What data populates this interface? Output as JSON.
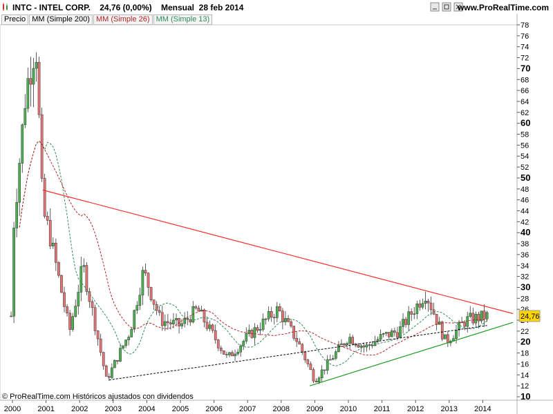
{
  "header": {
    "ticker": "INTC - INTEL CORP.",
    "price": "24,76 (0,00%)",
    "period": "Mensual  28 feb 2014",
    "site": "www.ProRealTime.com"
  },
  "legend": {
    "precio": "Precio",
    "ma200": "MM (Simple 200)",
    "ma26": "MM (Simple 26)",
    "ma13": "MM (Simple 13)"
  },
  "footer": {
    "copyright": "© ProRealTime.com Históricos ajustados con dividendos"
  },
  "chart_data": {
    "type": "candlestick",
    "title": "INTC - INTEL CORP.",
    "ylim": [
      10,
      79
    ],
    "y_ticks": [
      10,
      12,
      14,
      16,
      18,
      20,
      22,
      24,
      26,
      28,
      30,
      32,
      34,
      36,
      38,
      40,
      42,
      44,
      46,
      48,
      50,
      52,
      54,
      56,
      58,
      60,
      62,
      64,
      66,
      68,
      70,
      72,
      74,
      76,
      78
    ],
    "y_ticks_bold": [
      10,
      20,
      30,
      40,
      50,
      60,
      70
    ],
    "x_ticks": [
      "2000",
      "2001",
      "2002",
      "2003",
      "2004",
      "2005",
      "2006",
      "2007",
      "2008",
      "2009",
      "2010",
      "2011",
      "2012",
      "2013",
      "2014"
    ],
    "last_value": "24,76",
    "colors": {
      "up": "#4caf50",
      "down": "#e57373",
      "ma200": "#000000",
      "ma26": "#b22222",
      "ma13": "#2e8b57",
      "resistance": "#ff2a2a",
      "support": "#1a9a1a"
    },
    "key_prices": [
      {
        "date": "2000.0",
        "close": 39
      },
      {
        "date": "2000.4",
        "close": 66
      },
      {
        "date": "2000.7",
        "close": 75
      },
      {
        "date": "2000.9",
        "close": 44
      },
      {
        "date": "2001.1",
        "close": 40
      },
      {
        "date": "2001.7",
        "close": 22
      },
      {
        "date": "2002.1",
        "close": 34
      },
      {
        "date": "2002.8",
        "close": 13
      },
      {
        "date": "2003.5",
        "close": 22
      },
      {
        "date": "2003.9",
        "close": 33
      },
      {
        "date": "2004.4",
        "close": 24
      },
      {
        "date": "2005.0",
        "close": 23
      },
      {
        "date": "2005.5",
        "close": 26
      },
      {
        "date": "2006.4",
        "close": 17
      },
      {
        "date": "2007.0",
        "close": 21
      },
      {
        "date": "2007.9",
        "close": 26
      },
      {
        "date": "2008.5",
        "close": 20
      },
      {
        "date": "2009.0",
        "close": 13
      },
      {
        "date": "2009.5",
        "close": 17
      },
      {
        "date": "2010.0",
        "close": 21
      },
      {
        "date": "2010.5",
        "close": 19
      },
      {
        "date": "2011.0",
        "close": 21
      },
      {
        "date": "2011.5",
        "close": 22
      },
      {
        "date": "2012.3",
        "close": 29
      },
      {
        "date": "2012.9",
        "close": 20
      },
      {
        "date": "2013.5",
        "close": 24
      },
      {
        "date": "2014.1",
        "close": 24.76
      }
    ],
    "trendlines": [
      {
        "name": "resistance",
        "from": {
          "date": "2000.9",
          "price": 47.8
        },
        "to": {
          "date": "2014.9",
          "price": 25.2
        }
      },
      {
        "name": "support",
        "from": {
          "date": "2008.85",
          "price": 12.0
        },
        "to": {
          "date": "2014.9",
          "price": 23.6
        }
      }
    ]
  }
}
